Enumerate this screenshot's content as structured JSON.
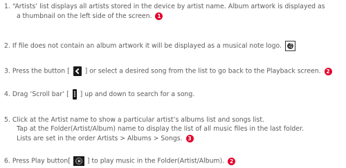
{
  "steps": {
    "s1": {
      "line1": "1. “Artists’ list displays all artists stored in the device by artist name. Album artwork is displayed as",
      "line2": "a thumbnail on the left side of the screen.",
      "badge": "1"
    },
    "s2": {
      "text": "2. If file does not contain an album artwork it will be displayed as a musical note logo.",
      "icon": "music-note-icon"
    },
    "s3": {
      "pre": "3. Press the button [",
      "post": "] or select a desired song from the list to go back to the Playback screen.",
      "icon": "back-chevron-icon",
      "badge": "2"
    },
    "s4": {
      "pre": "4. Drag ‘Scroll bar’ [",
      "post": "] up and down to search for a song.",
      "icon": "scroll-bar-icon"
    },
    "s5": {
      "line1": "5. Click at the Artist name to show a particular artist’s albums list and songs list.",
      "line2": "Tap at the Folder(Artist/Album) name to display the list of all music files in the last folder.",
      "line3": "Lists are set in the order Artists > Albums > Songs.",
      "badge": "3"
    },
    "s6": {
      "pre": "6. Press Play button[",
      "post": "] to play music in the Folder(Artist/Album).",
      "icon": "play-button-icon",
      "badge": "2"
    }
  },
  "colors": {
    "text": "#5a5a5a",
    "badge": "#e4002b",
    "icon_dark": "#1a1a1a"
  }
}
